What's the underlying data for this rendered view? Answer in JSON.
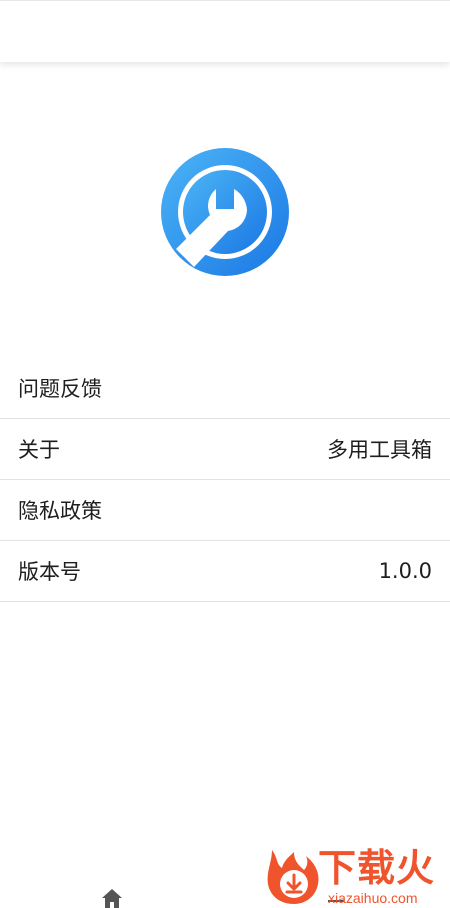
{
  "menu": {
    "items": [
      {
        "label": "问题反馈",
        "value": ""
      },
      {
        "label": "关于",
        "value": "多用工具箱"
      },
      {
        "label": "隐私政策",
        "value": ""
      },
      {
        "label": "版本号",
        "value": "1.0.0"
      }
    ]
  },
  "bottom_nav": {
    "icons": [
      "home-icon",
      "nav-indicator"
    ]
  },
  "watermark": {
    "title": "下载火",
    "subtitle": "xiazaihuo.com"
  },
  "colors": {
    "logo_blue_light": "#36a4f2",
    "logo_blue_dark": "#1f7fe6",
    "watermark_orange": "#f0542d",
    "divider": "#e2e2e2",
    "text": "#1e1e1e"
  }
}
